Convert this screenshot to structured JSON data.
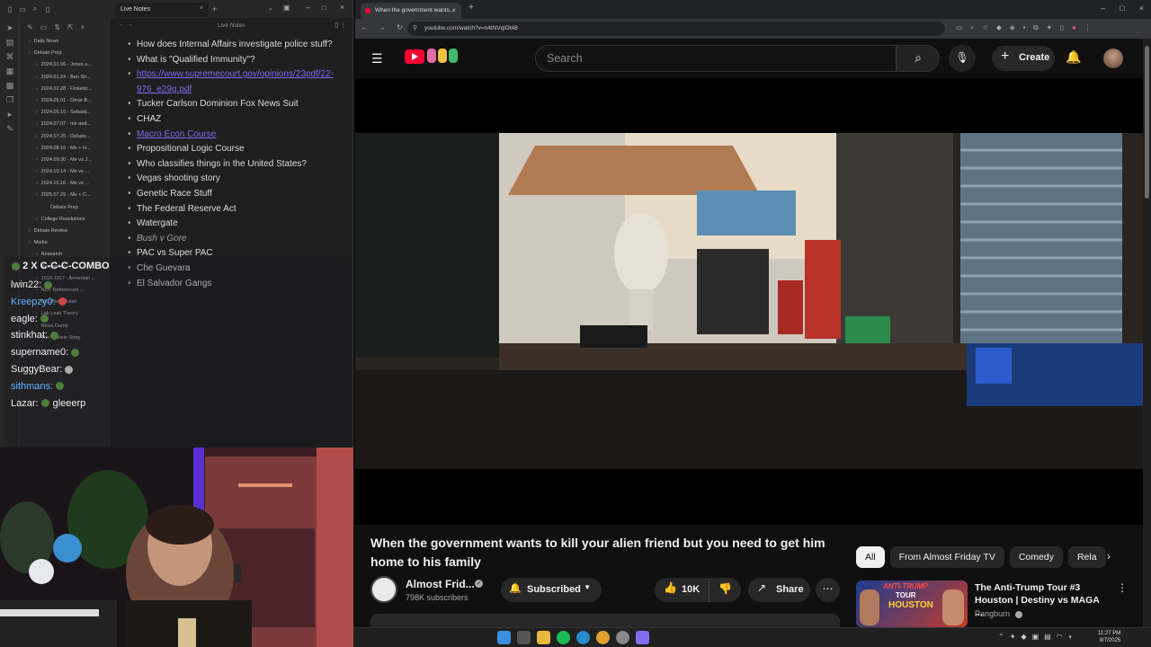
{
  "obsidian": {
    "tab_title": "Live Notes",
    "header_title": "Live Notes",
    "tree": [
      {
        "label": "Daily News",
        "level": 0
      },
      {
        "label": "Debate Prep",
        "level": 0
      },
      {
        "label": "2024.01.06 - Jones a...",
        "level": 1
      },
      {
        "label": "2024.01.24 - Ben Sh...",
        "level": 1
      },
      {
        "label": "2024.02.28 - Finkelst...",
        "level": 1
      },
      {
        "label": "2024.05.01 - Omar B...",
        "level": 1
      },
      {
        "label": "2024.05.10 - Sebasti...",
        "level": 1
      },
      {
        "label": "2024.07.07 - me and...",
        "level": 1
      },
      {
        "label": "2024.07.25 - Debate...",
        "level": 1
      },
      {
        "label": "2024.08.16 - Me + H...",
        "level": 1
      },
      {
        "label": "2024.09.30 - Me vs J...",
        "level": 1
      },
      {
        "label": "2024.10.14 - Me vs ...",
        "level": 1
      },
      {
        "label": "2024.10.16 - Me vs ...",
        "level": 1
      },
      {
        "label": "2025.07.29 - Me + C...",
        "level": 1
      },
      {
        "label": "Debate Prep",
        "level": 2
      },
      {
        "label": "College Resolutions",
        "level": 1
      },
      {
        "label": "Debate Review",
        "level": 0
      },
      {
        "label": "Media",
        "level": 0
      },
      {
        "label": "Research",
        "level": 1
      },
      {
        "label": "Remember",
        "level": 1
      },
      {
        "label": "1915-1917 - Armenian ...",
        "level": 1
      },
      {
        "label": "NOT Referenced ...",
        "level": 1
      },
      {
        "label": "Dr. Zhang Jixian",
        "level": 1
      },
      {
        "label": "Lab Leak Theory",
        "level": 1
      },
      {
        "label": "News Dump",
        "level": 1
      },
      {
        "label": "The Epstein Story",
        "level": 1
      }
    ],
    "notes": [
      {
        "text": "How does Internal Affairs investigate police stuff?",
        "style": "normal"
      },
      {
        "text": "What is \"Qualified Immunity\"?",
        "style": "normal"
      },
      {
        "text": "https://www.supremecourt.gov/opinions/23pdf/22-976_e29g.pdf",
        "style": "link"
      },
      {
        "text": "Tucker Carlson Dominion Fox News Suit",
        "style": "normal"
      },
      {
        "text": "CHAZ",
        "style": "normal"
      },
      {
        "text": "Macro Econ Course",
        "style": "link"
      },
      {
        "text": "Propositional Logic Course",
        "style": "normal"
      },
      {
        "text": "Who classifies things in the United States?",
        "style": "normal"
      },
      {
        "text": "Vegas shooting story",
        "style": "normal"
      },
      {
        "text": "Genetic Race Stuff",
        "style": "normal"
      },
      {
        "text": "The Federal Reserve Act",
        "style": "normal"
      },
      {
        "text": "Watergate",
        "style": "normal"
      },
      {
        "text": "Bush v Gore",
        "style": "italic"
      },
      {
        "text": "PAC vs Super PAC",
        "style": "normal"
      },
      {
        "text": "Che Guevara",
        "style": "normal"
      },
      {
        "text": "El Salvador Gangs",
        "style": "normal"
      }
    ]
  },
  "chat": {
    "combo": "2 X C-C-C-COMBO",
    "lines": [
      {
        "user": "lwin22:",
        "color": "white"
      },
      {
        "user": "Kreepzy0:",
        "color": "blue"
      },
      {
        "user": "eagle:",
        "color": "white"
      },
      {
        "user": "stinkhat:",
        "color": "white"
      },
      {
        "user": "supername0:",
        "color": "white"
      },
      {
        "user": "SuggyBear:",
        "color": "white"
      },
      {
        "user": "sithmans:",
        "color": "blue"
      },
      {
        "user": "Lazar:",
        "color": "white",
        "message": "gleeerp"
      }
    ]
  },
  "browser": {
    "tab_title": "When the government wants...",
    "url": "youtube.com/watch?v=n4tNVqiOt48"
  },
  "youtube": {
    "search_placeholder": "Search",
    "create_label": "Create",
    "video_title": "When the government wants to kill your alien friend but you need to get him home to his family",
    "channel_name": "Almost Frid...",
    "subscribers": "798K subscribers",
    "subscribed_label": "Subscribed",
    "likes": "10K",
    "share_label": "Share",
    "chips": [
      "All",
      "From Almost Friday TV",
      "Comedy",
      "Rela"
    ],
    "recommended": {
      "title": "The Anti-Trump Tour #3 Houston | Destiny vs MAGA ...",
      "channel": "Pangburn",
      "thumb_text_1": "ANTI-TRUMP",
      "thumb_text_2": "TOUR",
      "thumb_text_3": "HOUSTON"
    }
  },
  "taskbar": {
    "time": "11:27 PM",
    "date": "8/7/2025"
  }
}
